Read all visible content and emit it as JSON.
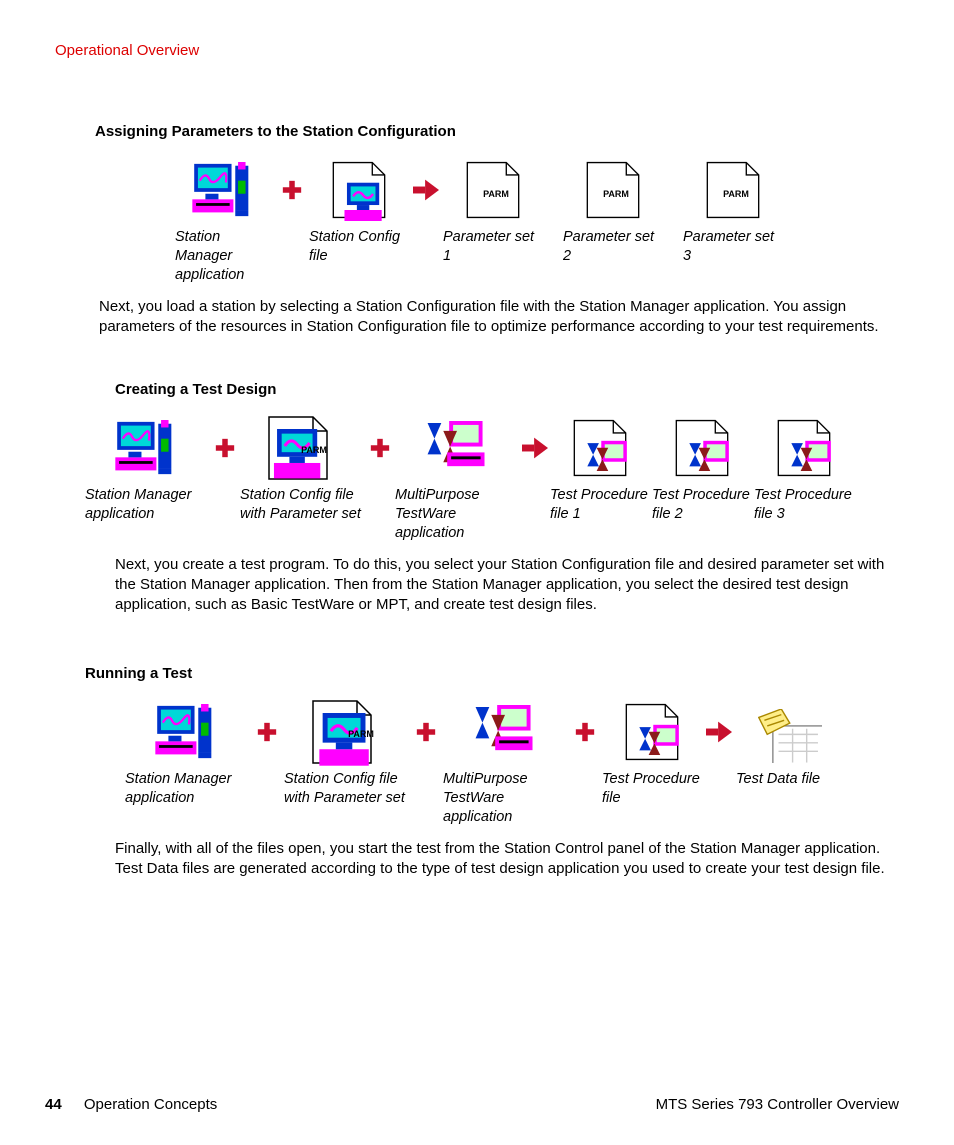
{
  "page_header": "Operational Overview",
  "sections": {
    "assign": {
      "heading": "Assigning Parameters to the Station Configuration",
      "items": {
        "sma": "Station Manager application",
        "scf": "Station Config file",
        "p1": "Parameter set 1",
        "p2": "Parameter set 2",
        "p3": "Parameter set 3"
      },
      "parm_label": "PARM",
      "body": "Next, you load a station by selecting a Station Configuration file with the Station Manager application. You assign parameters of the resources in Station Configuration file to optimize performance according to your test requirements."
    },
    "create": {
      "heading": "Creating a Test Design",
      "items": {
        "sma": "Station Manager application",
        "scfp": "Station Config file with Parameter set",
        "mpt": "MultiPurpose TestWare application",
        "tp1": "Test Procedure file 1",
        "tp2": "Test Procedure file 2",
        "tp3": "Test Procedure file 3"
      },
      "parm_label": "PARM",
      "body": "Next, you create a test program. To do this, you select your Station Configuration file and desired parameter set with the Station Manager application. Then from the Station Manager application, you select the desired test design application, such as Basic TestWare or MPT, and create test design files."
    },
    "run": {
      "heading": "Running a Test",
      "items": {
        "sma": "Station Manager application",
        "scfp": "Station Config file with Parameter set",
        "mpt": "MultiPurpose TestWare application",
        "tpf": "Test Procedure file",
        "tdf": "Test Data file"
      },
      "parm_label": "PARM",
      "body": "Finally, with all of the files open, you start the test from the Station Control panel of the Station Manager application. Test Data files are generated according to the type of test design application you used to create your test design file."
    }
  },
  "footer": {
    "page": "44",
    "left": "Operation Concepts",
    "right": "MTS Series 793 Controller Overview"
  }
}
